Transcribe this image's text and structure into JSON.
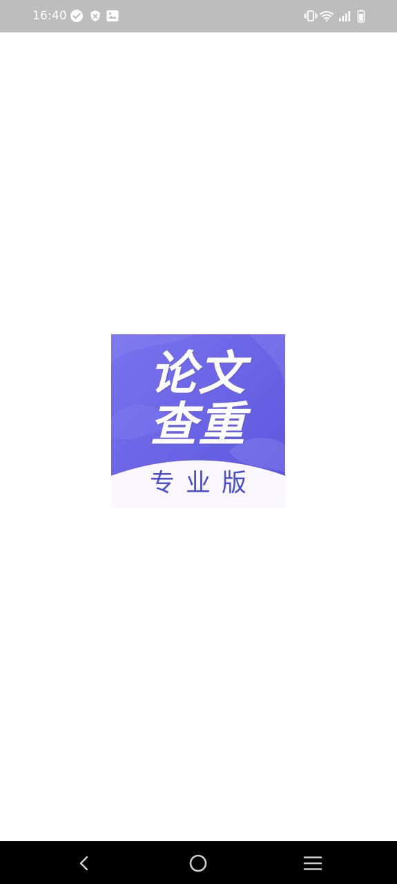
{
  "status_bar": {
    "time": "16:40",
    "left_icons": [
      "check-circle-icon",
      "shield-icon",
      "image-icon"
    ],
    "right_icons": [
      "vibrate-icon",
      "wifi-icon",
      "signal-icon",
      "battery-icon"
    ]
  },
  "splash": {
    "logo": {
      "title_line_1": "论文",
      "title_line_2": "查重",
      "subtitle": "专业版",
      "colors": {
        "background": "#6b63e6",
        "title": "#ffffff",
        "subtitle": "#4a4fcf",
        "band": "#fbf7ff"
      }
    }
  },
  "nav_bar": {
    "buttons": [
      "back-icon",
      "home-icon",
      "menu-icon"
    ]
  }
}
